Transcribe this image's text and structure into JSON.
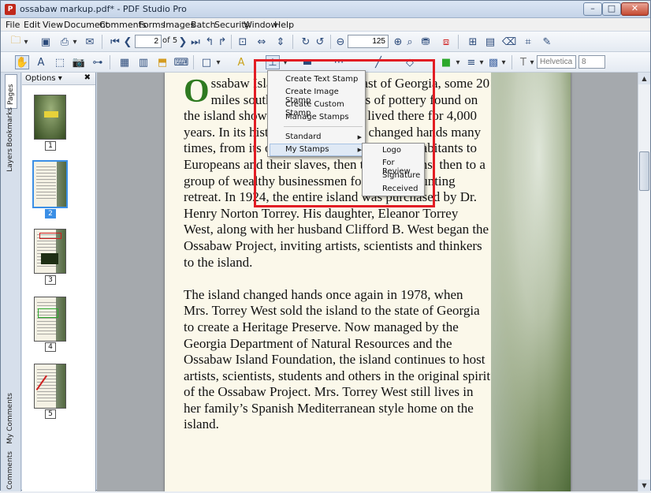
{
  "window": {
    "title": "ossabaw markup.pdf* - PDF Studio Pro",
    "app_icon": "pdf-app-icon",
    "controls": {
      "minimize": "–",
      "maximize": "□",
      "close": "✕"
    }
  },
  "menubar": [
    "File",
    "Edit",
    "View",
    "Document",
    "Comments",
    "Forms",
    "Images",
    "Batch",
    "Security",
    "Window",
    "Help"
  ],
  "toolbar1": {
    "page_number": "2",
    "page_total": "of 5",
    "zoom": "125"
  },
  "toolbar2": {
    "font_name": "Helvetica",
    "font_size": "8"
  },
  "side_tabs": [
    "Pages",
    "Bookmarks",
    "Layers",
    "My Comments",
    "Comments"
  ],
  "thumb_panel": {
    "options_label": "Options ▾",
    "close_label": "✖",
    "pages": [
      "1",
      "2",
      "3",
      "4",
      "5"
    ],
    "selected_page": "2"
  },
  "document": {
    "dropcap": "O",
    "para1": "ssabaw Island lies off the coast of Georgia, some 20 miles south of Savannah. Bits of pottery found on the island show that humans have lived there for 4,000 years. In its history, the island has changed hands many times, from its original Native American inhabitants to Euro­peans and their slaves, then to plantations, then to a group of wealthy businessmen for use as a hunting retreat. In 1924, the entire island was purchased by Dr. Henry Norton Torrey. His daughter, Eleanor Torrey West, along with her husband Clifford B. West began the Ossabaw Project, inviting artists, scientists and thinkers to the island.",
    "para2": "The island changed hands once again in 1978, when Mrs. Torrey West sold the island to the state of Georgia to create a Heritage Preserve. Now managed by the Georgia Department of Natural Resources and the Ossabaw Island Foundation, the island continues to host artists, scientists, students and others in the original spirit of the Ossabaw Project. Mrs. Torrey West still lives in her family’s Spanish Mediterranean style home on the island."
  },
  "stamp_menu": {
    "items": [
      "Create Text Stamp",
      "Create Image Stamp",
      "Create Custom Stamp",
      "Manage Stamps"
    ],
    "standard": "Standard",
    "my_stamps": "My Stamps"
  },
  "submenu": {
    "items": [
      "Logo",
      "For Review",
      "Signature",
      "Received"
    ]
  },
  "colors": {
    "highlight_box": "#e21d24",
    "dropcap": "#2e7a20",
    "selection": "#3b8fe6"
  }
}
